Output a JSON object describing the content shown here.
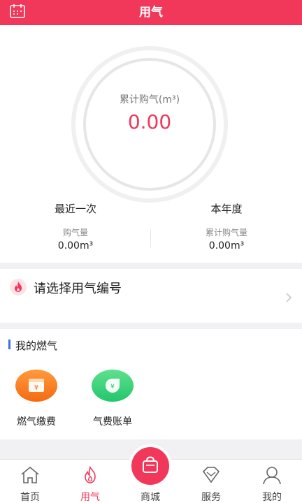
{
  "header": {
    "title": "用气",
    "calendar_icon": "calendar-icon"
  },
  "summary": {
    "label": "累计购气(m³)",
    "value": "0.00",
    "accent": "#f2385a"
  },
  "stats": {
    "recent": {
      "heading": "最近一次",
      "sub": "购气量",
      "value": "0.00m³"
    },
    "year": {
      "heading": "本年度",
      "sub": "累计购气量",
      "value": "0.00m³"
    }
  },
  "select": {
    "text": "请选择用气编号",
    "icon": "flame-icon",
    "chevron": "chevron-right-icon"
  },
  "my_gas": {
    "title": "我的燃气",
    "services": [
      {
        "label": "燃气缴费",
        "icon": "payment-icon",
        "color": "#f56a12"
      },
      {
        "label": "气费账单",
        "icon": "bill-icon",
        "color": "#22c66a"
      }
    ]
  },
  "tabs": [
    {
      "label": "首页",
      "icon": "home-icon"
    },
    {
      "label": "用气",
      "icon": "flame-icon",
      "active": true
    },
    {
      "label": "商城",
      "icon": "shopping-bag-icon"
    },
    {
      "label": "服务",
      "icon": "diamond-icon"
    },
    {
      "label": "我的",
      "icon": "user-icon"
    }
  ]
}
